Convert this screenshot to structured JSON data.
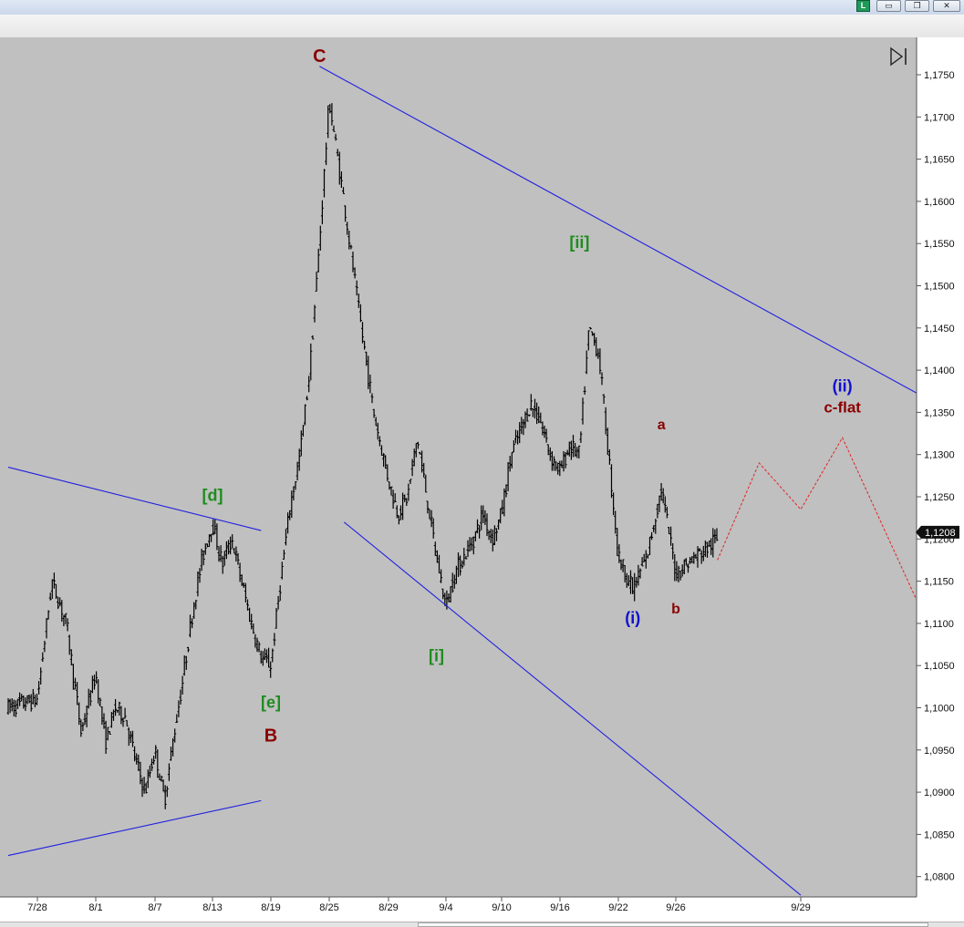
{
  "window": {
    "badge_label": "L",
    "minimize_glyph": "▭",
    "restore_glyph": "❐",
    "close_glyph": "✕"
  },
  "chart_data": {
    "type": "bar",
    "subtype": "ohlc",
    "x_axis_labels": [
      "7/28",
      "8/1",
      "8/7",
      "8/13",
      "8/19",
      "8/25",
      "8/29",
      "9/4",
      "9/10",
      "9/16",
      "9/22",
      "9/26",
      "9/29"
    ],
    "y_axis_labels": [
      "1,1750",
      "1,1700",
      "1,1650",
      "1,1600",
      "1,1550",
      "1,1500",
      "1,1450",
      "1,1400",
      "1,1350",
      "1,1300",
      "1,1250",
      "1,1200",
      "1,1150",
      "1,1100",
      "1,1050",
      "1,1000",
      "1,0950",
      "1,0900",
      "1,0850",
      "1,0800"
    ],
    "ylim": [
      1.0778,
      1.179
    ],
    "price_tag": {
      "label": "1,1208",
      "value": 1.1208
    },
    "price_path": [
      {
        "x": "7/26",
        "y": 1.1
      },
      {
        "x": "7/28",
        "y": 1.101
      },
      {
        "x": "7/29",
        "y": 1.115
      },
      {
        "x": "7/30",
        "y": 1.11
      },
      {
        "x": "7/31",
        "y": 1.097
      },
      {
        "x": "8/1",
        "y": 1.104
      },
      {
        "x": "8/2",
        "y": 1.096
      },
      {
        "x": "8/3",
        "y": 1.1
      },
      {
        "x": "8/4",
        "y": 1.099
      },
      {
        "x": "8/5",
        "y": 1.094
      },
      {
        "x": "8/6",
        "y": 1.09
      },
      {
        "x": "8/7",
        "y": 1.095
      },
      {
        "x": "8/8",
        "y": 1.089
      },
      {
        "x": "8/9",
        "y": 1.097
      },
      {
        "x": "8/10",
        "y": 1.104
      },
      {
        "x": "8/11",
        "y": 1.112
      },
      {
        "x": "8/12",
        "y": 1.118
      },
      {
        "x": "8/13",
        "y": 1.122
      },
      {
        "x": "8/14",
        "y": 1.117
      },
      {
        "x": "8/15",
        "y": 1.12
      },
      {
        "x": "8/16",
        "y": 1.115
      },
      {
        "x": "8/17",
        "y": 1.11
      },
      {
        "x": "8/18",
        "y": 1.106
      },
      {
        "x": "8/19",
        "y": 1.105
      },
      {
        "x": "8/20",
        "y": 1.115
      },
      {
        "x": "8/21",
        "y": 1.124
      },
      {
        "x": "8/22",
        "y": 1.13
      },
      {
        "x": "8/23",
        "y": 1.14
      },
      {
        "x": "8/24",
        "y": 1.155
      },
      {
        "x": "8/25",
        "y": 1.172
      },
      {
        "x": "8/26",
        "y": 1.16
      },
      {
        "x": "8/27",
        "y": 1.147
      },
      {
        "x": "8/28",
        "y": 1.135
      },
      {
        "x": "8/29",
        "y": 1.127
      },
      {
        "x": "8/30",
        "y": 1.123
      },
      {
        "x": "8/31",
        "y": 1.125
      },
      {
        "x": "9/1",
        "y": 1.132
      },
      {
        "x": "9/2",
        "y": 1.125
      },
      {
        "x": "9/3",
        "y": 1.118
      },
      {
        "x": "9/4",
        "y": 1.112
      },
      {
        "x": "9/5",
        "y": 1.116
      },
      {
        "x": "9/6",
        "y": 1.118
      },
      {
        "x": "9/7",
        "y": 1.12
      },
      {
        "x": "9/8",
        "y": 1.123
      },
      {
        "x": "9/9",
        "y": 1.12
      },
      {
        "x": "9/10",
        "y": 1.123
      },
      {
        "x": "9/11",
        "y": 1.13
      },
      {
        "x": "9/12",
        "y": 1.133
      },
      {
        "x": "9/13",
        "y": 1.136
      },
      {
        "x": "9/14",
        "y": 1.134
      },
      {
        "x": "9/15",
        "y": 1.13
      },
      {
        "x": "9/16",
        "y": 1.128
      },
      {
        "x": "9/17",
        "y": 1.131
      },
      {
        "x": "9/18",
        "y": 1.13
      },
      {
        "x": "9/19",
        "y": 1.145
      },
      {
        "x": "9/20",
        "y": 1.142
      },
      {
        "x": "9/21",
        "y": 1.13
      },
      {
        "x": "9/22",
        "y": 1.118
      },
      {
        "x": "9/23",
        "y": 1.114
      },
      {
        "x": "9/24",
        "y": 1.118
      },
      {
        "x": "9/25",
        "y": 1.126
      },
      {
        "x": "9/26",
        "y": 1.116
      },
      {
        "x": "9/27",
        "y": 1.12
      }
    ],
    "projection": [
      {
        "x": "9/27",
        "y": 1.1175
      },
      {
        "x": "9/28",
        "y": 1.129
      },
      {
        "x": "9/29",
        "y": 1.1235
      },
      {
        "x": "9/30",
        "y": 1.132
      },
      {
        "x": "10/5",
        "y": 1.078
      }
    ],
    "trendlines": [
      {
        "name": "triangle-upper",
        "points": [
          {
            "x": "7/26",
            "y": 1.1285
          },
          {
            "x": "8/18",
            "y": 1.121
          }
        ]
      },
      {
        "name": "triangle-lower",
        "points": [
          {
            "x": "7/26",
            "y": 1.0825
          },
          {
            "x": "8/18",
            "y": 1.089
          }
        ]
      },
      {
        "name": "channel-upper",
        "points": [
          {
            "x": "8/24",
            "y": 1.176
          },
          {
            "x": "10/9",
            "y": 1.1178
          }
        ]
      },
      {
        "name": "channel-lower",
        "points": [
          {
            "x": "8/26",
            "y": 1.122
          },
          {
            "x": "9/29",
            "y": 1.0778
          }
        ]
      }
    ],
    "wave_labels": [
      {
        "text": "C",
        "x": "8/24",
        "y": 1.1765,
        "color": "#8b0000"
      },
      {
        "text": "[d]",
        "x": "8/13",
        "y": 1.1245,
        "color": "#1e8c1e"
      },
      {
        "text": "[e]",
        "x": "8/19",
        "y": 1.1,
        "color": "#1e8c1e"
      },
      {
        "text": "B",
        "x": "8/19",
        "y": 1.096,
        "color": "#8b0000"
      },
      {
        "text": "[i]",
        "x": "9/3",
        "y": 1.1055,
        "color": "#1e8c1e"
      },
      {
        "text": "[ii]",
        "x": "9/18",
        "y": 1.1545,
        "color": "#1e8c1e"
      },
      {
        "text": "(i)",
        "x": "9/23",
        "y": 1.11,
        "color": "#1010d0"
      },
      {
        "text": "a",
        "x": "9/25",
        "y": 1.133,
        "color": "#8b0000"
      },
      {
        "text": "b",
        "x": "9/26",
        "y": 1.1112,
        "color": "#8b0000"
      },
      {
        "text": "(ii)",
        "x": "9/30",
        "y": 1.1375,
        "color": "#1010d0"
      },
      {
        "text": "c-flat",
        "x": "9/30",
        "y": 1.135,
        "color": "#8b0000"
      }
    ]
  }
}
